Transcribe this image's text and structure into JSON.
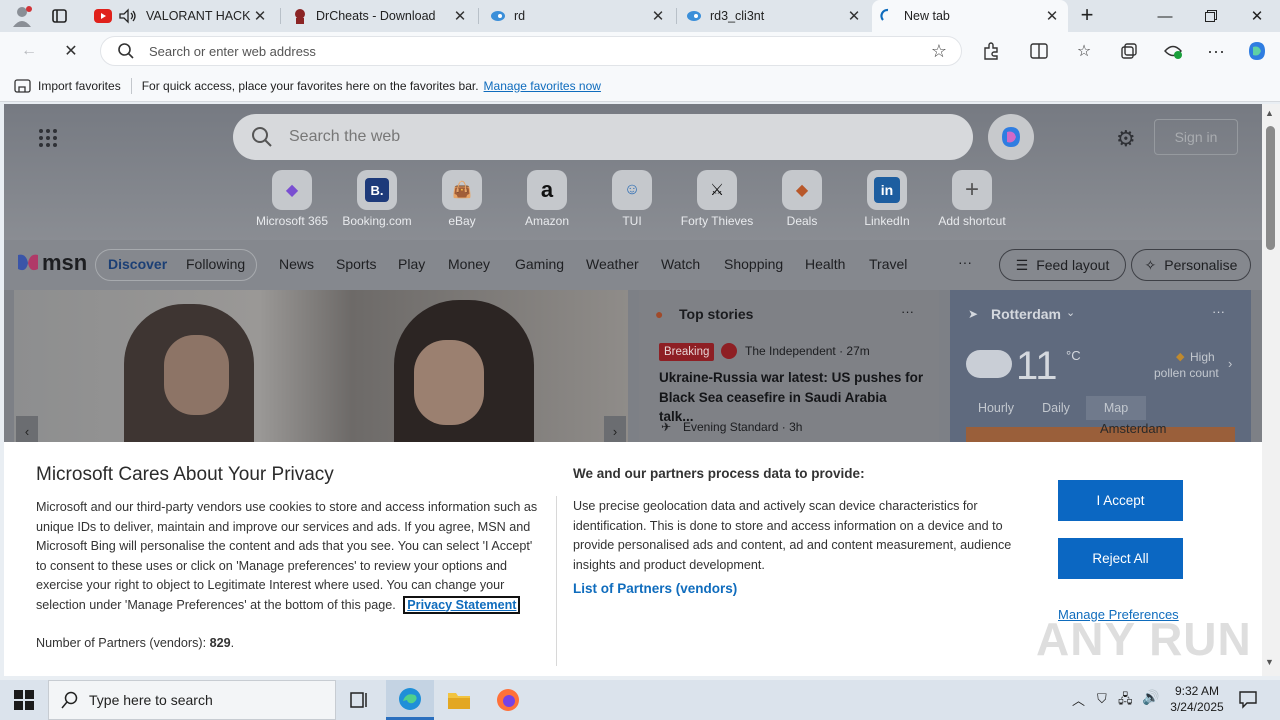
{
  "tabs": [
    {
      "label": "VALORANT HACK | "
    },
    {
      "label": "DrCheats - Download"
    },
    {
      "label": "rd"
    },
    {
      "label": "rd3_cli3nt"
    },
    {
      "label": "New tab"
    }
  ],
  "address": {
    "placeholder": "Search or enter web address"
  },
  "favorites": {
    "import_label": "Import favorites",
    "message": "For quick access, place your favorites here on the favorites bar.",
    "manage_link": "Manage favorites now"
  },
  "newtab": {
    "search_placeholder": "Search the web",
    "sign_in": "Sign in",
    "shortcuts": [
      "Microsoft 365",
      "Booking.com",
      "eBay",
      "Amazon",
      "TUI",
      "Forty Thieves",
      "Deals",
      "LinkedIn",
      "Add shortcut"
    ],
    "msn_logo": "msn",
    "nav_tabs": [
      "Discover",
      "Following"
    ],
    "nav_items": [
      "News",
      "Sports",
      "Play",
      "Money",
      "Gaming",
      "Weather",
      "Watch",
      "Shopping",
      "Health",
      "Travel"
    ],
    "more": "···",
    "feed_layout": "Feed layout",
    "personalise": "Personalise",
    "top_stories": {
      "title": "Top stories",
      "badge": "Breaking",
      "source1": "The Independent · 27m",
      "headline": "Ukraine-Russia war latest: US pushes for Black Sea ceasefire in Saudi Arabia talk...",
      "source2": "Evening Standard · 3h"
    },
    "weather": {
      "location": "Rotterdam",
      "temp": "11",
      "unit": "°C",
      "pollen_1": "High",
      "pollen_2": "pollen count",
      "tabs": [
        "Hourly",
        "Daily",
        "Map"
      ],
      "map_label": "Amsterdam"
    }
  },
  "privacy": {
    "title": "Microsoft Cares About Your Privacy",
    "body": "Microsoft and our third-party vendors use cookies to store and access information such as unique IDs to deliver, maintain and improve our services and ads. If you agree, MSN and Microsoft Bing will personalise the content and ads that you see. You can select 'I Accept' to consent to these uses or click on 'Manage preferences' to review your options and exercise your right to object to Legitimate Interest where used.  You can change your selection under 'Manage Preferences' at the bottom of this page.",
    "privacy_link": "Privacy Statement",
    "partners_label": "Number of Partners (vendors):",
    "partners_count": "829",
    "period": ".",
    "right_title": "We and our partners process data to provide:",
    "right_body": "Use precise geolocation data and actively scan device characteristics for identification. This is done to store and access information on a device and to provide personalised ads and content, ad and content measurement, audience insights and product development.",
    "partners_link": "List of Partners (vendors)",
    "accept": "I Accept",
    "reject": "Reject All",
    "manage": "Manage Preferences"
  },
  "watermark": "ANY RUN",
  "taskbar": {
    "search_placeholder": "Type here to search",
    "time": "9:32 AM",
    "date": "3/24/2025"
  },
  "colors": {
    "accent": "#0b67c2",
    "link": "#0f6cbd",
    "dim_overlay": "#7c7f86"
  }
}
